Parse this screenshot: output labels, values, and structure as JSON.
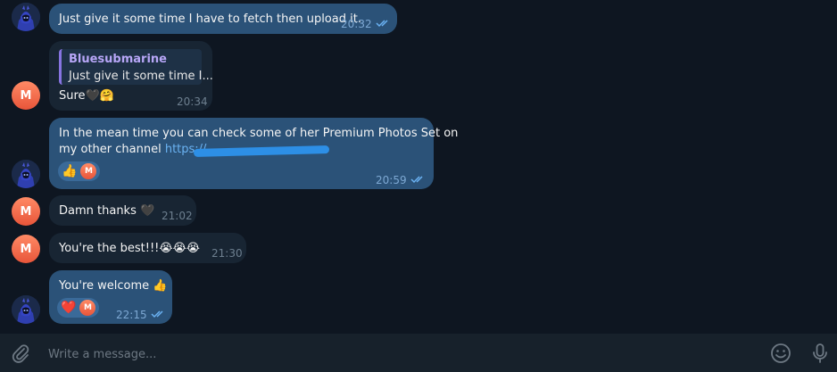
{
  "messages": [
    {
      "id": "m1",
      "text": "Just give it some time I have to fetch then upload it.",
      "time": "20:32"
    },
    {
      "id": "m2",
      "reply_name": "Bluesubmarine",
      "reply_text": "Just give it some time I...",
      "text": "Sure🖤🤗",
      "time": "20:34",
      "avatar_letter": "M"
    },
    {
      "id": "m3",
      "line1": "In the mean time you can check some of her Premium Photos Set on",
      "line2_prefix": "my other channel ",
      "link": "https://",
      "reaction_emoji": "👍",
      "reaction_avatar": "M",
      "time": "20:59"
    },
    {
      "id": "m4",
      "text": "Damn thanks 🖤",
      "time": "21:02",
      "avatar_letter": "M"
    },
    {
      "id": "m5",
      "text": "You're the best!!!😭😭😭",
      "time": "21:30",
      "avatar_letter": "M"
    },
    {
      "id": "m6",
      "text": "You're welcome 👍",
      "reaction_emoji": "❤️",
      "reaction_avatar": "M",
      "time": "22:15"
    }
  ],
  "composer": {
    "placeholder": "Write a message..."
  },
  "icons": {
    "attach": "paperclip-icon",
    "emoji": "smiley-icon",
    "mic": "microphone-icon",
    "read": "double-check-icon",
    "avatar": "hooded-character-avatar"
  },
  "colors": {
    "background": "#0e1621",
    "incoming": "#182533",
    "outgoing": "#2b5278",
    "link": "#6ab2f2",
    "checks": "#6ab2f2"
  }
}
